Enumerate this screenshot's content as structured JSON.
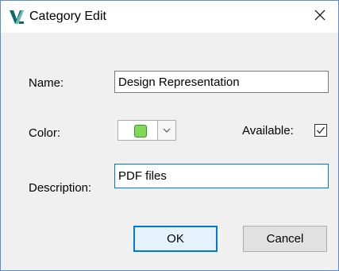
{
  "window": {
    "title": "Category Edit",
    "close_glyph": "✕",
    "app_icon": "autodesk-vault-logo",
    "accent_color": "#5b8ec9"
  },
  "form": {
    "name_label": "Name:",
    "name_value": "Design Representation",
    "color_label": "Color:",
    "color_value": "#7ed957",
    "available_label": "Available:",
    "available_checked": true,
    "description_label": "Description:",
    "description_value": "PDF files"
  },
  "buttons": {
    "ok_label": "OK",
    "cancel_label": "Cancel"
  }
}
